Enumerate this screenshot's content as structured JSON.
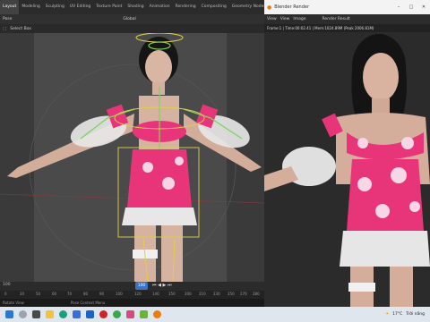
{
  "workspace_tabs": [
    "Layout",
    "Modeling",
    "Sculpting",
    "UV Editing",
    "Texture Paint",
    "Shading",
    "Animation",
    "Rendering",
    "Compositing",
    "Geometry Nodes",
    "Scripting",
    "+"
  ],
  "active_tab": "Layout",
  "viewport": {
    "mode_label": "Pose",
    "select_label": "Select Box",
    "transform_label": "Global"
  },
  "timeline": {
    "current_frame": "100",
    "ticks": [
      "0",
      "20",
      "50",
      "60",
      "70",
      "80",
      "90",
      "100",
      "120",
      "140",
      "150",
      "200",
      "210",
      "230",
      "250",
      "270",
      "280"
    ],
    "frame_marker_label": "100"
  },
  "status_bar": {
    "left": "Rotate View",
    "middle": "Pose Context Menu"
  },
  "render_window": {
    "title": "Blender Render",
    "menus": [
      "View",
      "View",
      "Image"
    ],
    "slot_label": "Render Result",
    "info": "Frame:1 | Time:00:02.41 | Mem:1024.89M (Peak 2006.81M)"
  },
  "taskbar": {
    "weather": "17°C",
    "weather_desc": "Trời nắng"
  },
  "colors": {
    "bone_green": "#7ed35a",
    "bone_yellow": "#d9c24a",
    "dress_pink": "#e8357a",
    "skin": "#d8b7a6"
  }
}
